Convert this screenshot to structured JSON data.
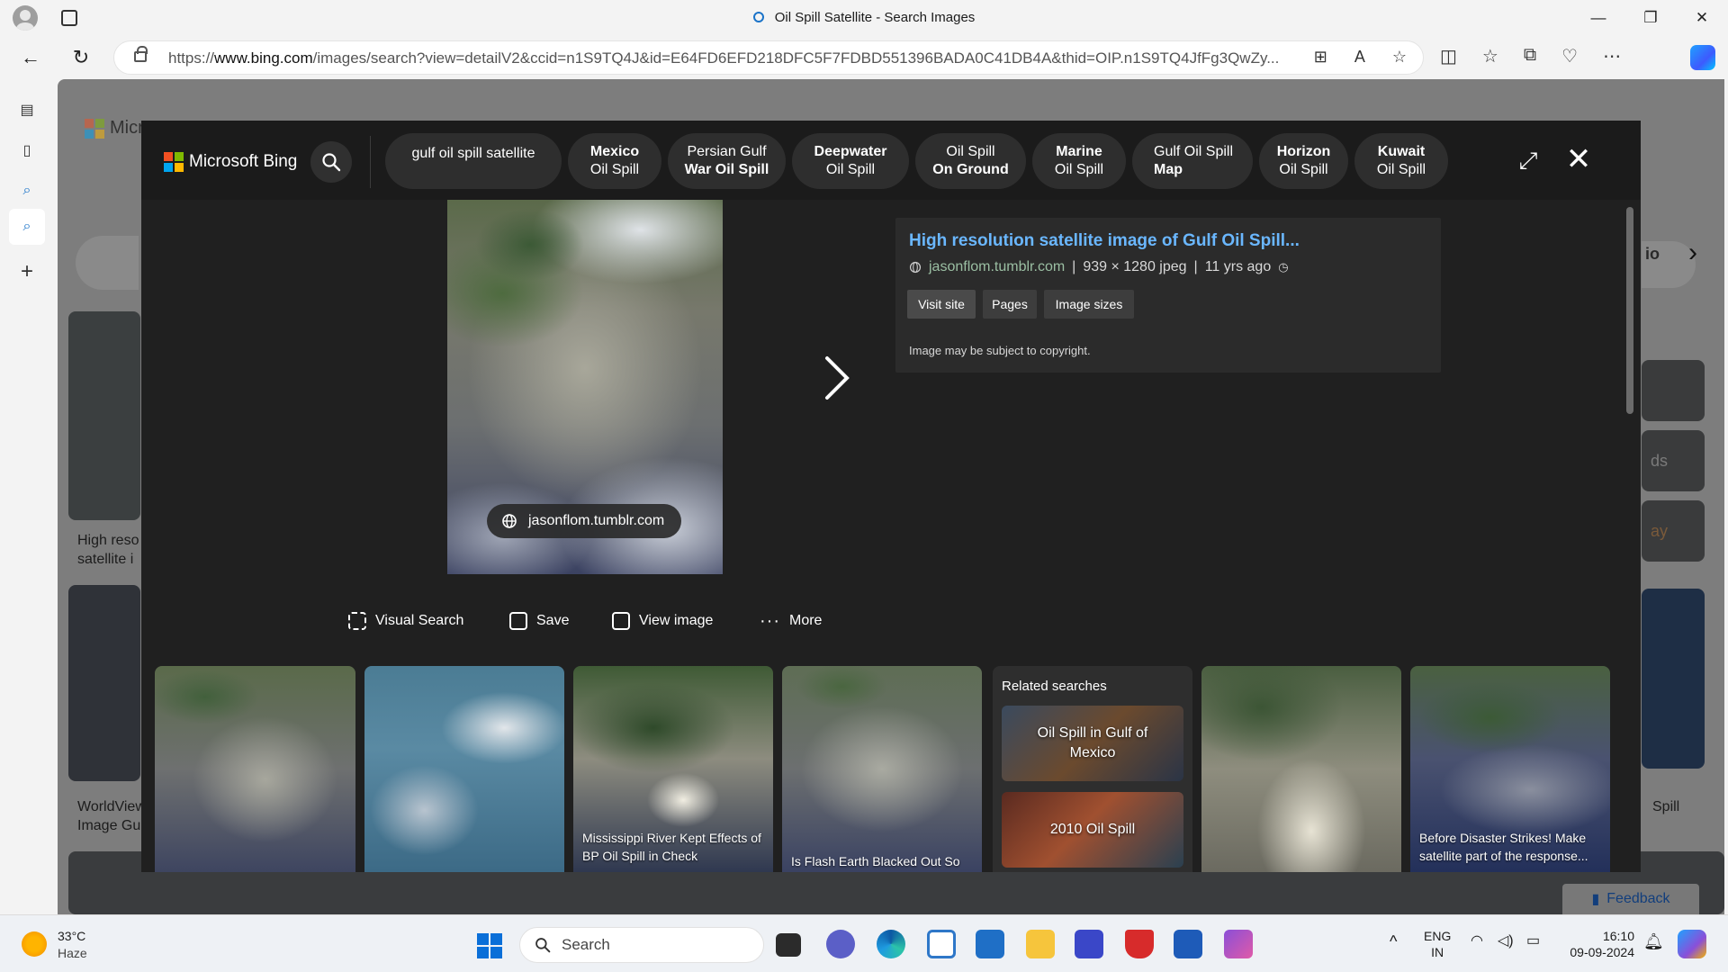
{
  "window": {
    "title": "Oil Spill Satellite - Search Images",
    "minimize": "—",
    "maximize": "❐",
    "close": "✕"
  },
  "address_bar": {
    "url_prefix": "https://",
    "url_domain": "www.bing.com",
    "url_rest": "/images/search?view=detailV2&ccid=n1S9TQ4J&id=E64FD6EFD218DFC5F7FDBD551396BADA0C41DB4A&thid=OIP.n1S9TQ4JfFg3QwZy..."
  },
  "background_page": {
    "logo_text": "Micr",
    "result1_caption_line1": "High reso",
    "result1_caption_line2": "satellite i",
    "result2_caption_line1": "WorldView",
    "result2_caption_line2": "Image Gu",
    "right_caption": "Spill",
    "feedback": "Feedback",
    "right_chip_text": "io",
    "tile_text1": "ds",
    "tile_text2": "ay"
  },
  "modal": {
    "brand": "Microsoft Bing",
    "chips": [
      {
        "line1": "gulf oil spill satellite",
        "line2": ""
      },
      {
        "line1": "Mexico",
        "line2": "Oil Spill"
      },
      {
        "line1": "Persian Gulf",
        "line2": "War Oil Spill"
      },
      {
        "line1": "Deepwater",
        "line2": "Oil Spill"
      },
      {
        "line1": "Oil Spill",
        "line2": "On Ground"
      },
      {
        "line1": "Marine",
        "line2": "Oil Spill"
      },
      {
        "line1": "Gulf Oil Spill",
        "line2": "Map"
      },
      {
        "line1": "Horizon",
        "line2": "Oil Spill"
      },
      {
        "line1": "Kuwait",
        "line2": "Oil Spill"
      }
    ],
    "image_source_pill": "jasonflom.tumblr.com",
    "info": {
      "title": "High resolution satellite image of Gulf Oil Spill...",
      "source": "jasonflom.tumblr.com",
      "dimensions": "939 × 1280 jpeg",
      "age": "11 yrs ago",
      "separator": "|",
      "buttons": [
        "Visit site",
        "Pages",
        "Image sizes"
      ],
      "copyright": "Image may be subject to copyright."
    },
    "actions": [
      "Visual Search",
      "Save",
      "View image",
      "More"
    ],
    "strip": {
      "caption_3": "Mississippi River Kept Effects of BP Oil Spill in Check",
      "caption_4": "Is Flash Earth Blacked Out So",
      "caption_7": "Before Disaster Strikes! Make satellite part of the response...",
      "related_title": "Related searches",
      "related": [
        "Oil Spill in Gulf of Mexico",
        "2010 Oil Spill"
      ]
    }
  },
  "taskbar": {
    "temperature": "33°C",
    "weather": "Haze",
    "search_placeholder": "Search",
    "lang_line1": "ENG",
    "lang_line2": "IN",
    "time": "16:10",
    "date": "09-09-2024"
  },
  "colors": {
    "bing_link": "#6ab7ff",
    "modal_bg": "#202020",
    "ms_red": "#f25022",
    "ms_green": "#7fba00",
    "ms_blue": "#00a4ef",
    "ms_yellow": "#ffb900"
  }
}
